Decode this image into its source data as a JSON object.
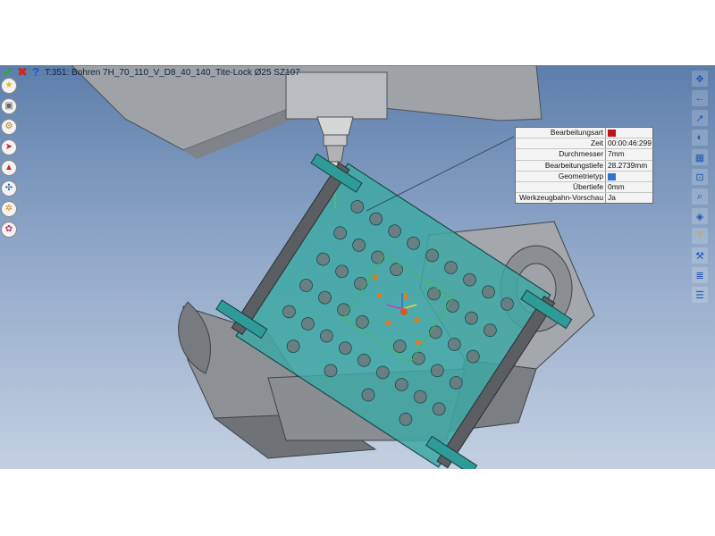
{
  "toolbar": {
    "ok_icon": "check-icon",
    "cancel_icon": "cross-icon",
    "help_label": "?",
    "operation_title": "T:351: Bohren 7H_70_110_V_D8_40_140_Tite-Lock Ø25 SZ107"
  },
  "left_toolbar": {
    "icons": [
      "star-icon",
      "machine-icon",
      "tool-icon",
      "toolpath-icon",
      "fixture-icon",
      "network-icon",
      "gear-icon",
      "flower-icon"
    ]
  },
  "right_toolbar": {
    "icons": [
      "move-icon",
      "arrow-icon",
      "link-icon",
      "camera-icon",
      "window-icon",
      "zoom-icon",
      "search-icon",
      "cube-icon",
      "help-icon",
      "tool-icon",
      "layers-icon",
      "stack-icon"
    ]
  },
  "info_panel": {
    "rows": [
      {
        "label": "Bearbeitungsart",
        "value": "",
        "swatch": "#c0141c"
      },
      {
        "label": "Zeit",
        "value": "00:00:46:299"
      },
      {
        "label": "Durchmesser",
        "value": "7mm"
      },
      {
        "label": "Bearbeitungstiefe",
        "value": "28.2739mm"
      },
      {
        "label": "Geometrietyp",
        "value": "",
        "swatch": "#2e76cf"
      },
      {
        "label": "Übertiefe",
        "value": "0mm"
      },
      {
        "label": "Werkzeugbahn-Vorschau",
        "value": "Ja"
      }
    ]
  },
  "colors": {
    "background_top": "#5d7eab",
    "background_bottom": "#c3d0e2",
    "machine": "#a9a9a9",
    "workpiece": "#3ea8a4",
    "clamps": "#2f9b98"
  }
}
